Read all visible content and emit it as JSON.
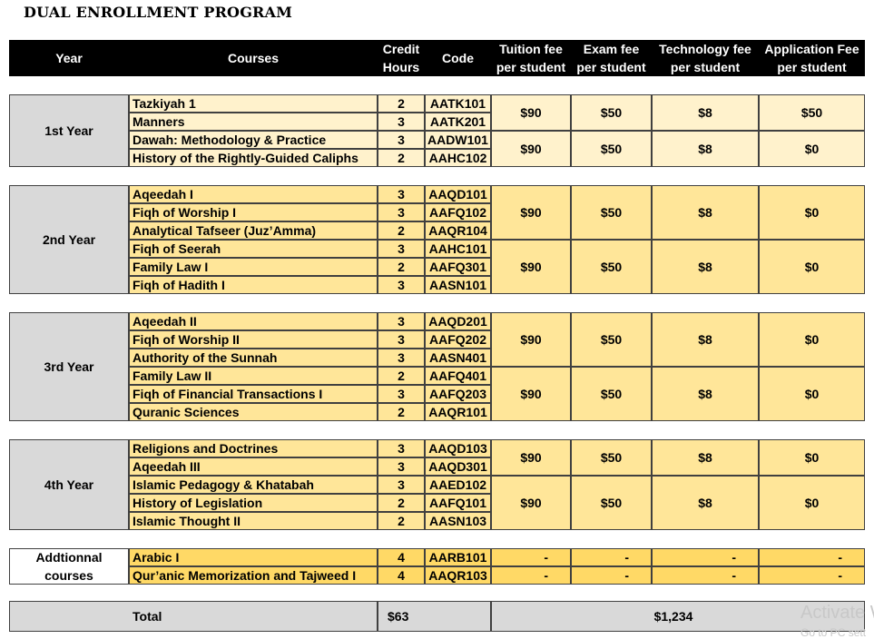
{
  "title": "DUAL ENROLLMENT PROGRAM",
  "colors": {
    "header_bg": "#000000",
    "header_text": "#ffffff",
    "year_bg": "#d9d9d9",
    "year1_row": "#fff2cc",
    "year2_4_row": "#ffe699",
    "additional_row": "#ffd966",
    "border": "#404040"
  },
  "header": {
    "year": "Year",
    "courses": "Courses",
    "credit_line1": "Credit",
    "credit_line2": "Hours",
    "code": "Code",
    "tuition_line1": "Tuition fee",
    "tuition_line2": "per student",
    "exam_line1": "Exam fee",
    "exam_line2": "per student",
    "tech_line1": "Technology fee",
    "tech_line2": "per student",
    "app_line1": "Application Fee",
    "app_line2": "per student"
  },
  "sections": [
    {
      "year": "1st Year",
      "courses": [
        {
          "name": "Tazkiyah 1",
          "credits": "2",
          "code": "AATK101"
        },
        {
          "name": "Manners",
          "credits": "3",
          "code": "AATK201"
        },
        {
          "name": "Dawah: Methodology & Practice",
          "credits": "3",
          "code": "AADW101"
        },
        {
          "name": "History of the Rightly-Guided Caliphs",
          "credits": "2",
          "code": "AAHC102"
        }
      ],
      "fee_groups": [
        {
          "rows": 2,
          "tuition": "$90",
          "exam": "$50",
          "tech": "$8",
          "app": "$50"
        },
        {
          "rows": 2,
          "tuition": "$90",
          "exam": "$50",
          "tech": "$8",
          "app": "$0"
        }
      ]
    },
    {
      "year": "2nd Year",
      "courses": [
        {
          "name": "Aqeedah I",
          "credits": "3",
          "code": "AAQD101"
        },
        {
          "name": "Fiqh of Worship I",
          "credits": "3",
          "code": "AAFQ102"
        },
        {
          "name": "Analytical Tafseer (Juz’Amma)",
          "credits": "2",
          "code": "AAQR104"
        },
        {
          "name": "Fiqh of Seerah",
          "credits": "3",
          "code": "AAHC101"
        },
        {
          "name": "Family Law I",
          "credits": "2",
          "code": "AAFQ301"
        },
        {
          "name": "Fiqh of Hadith I",
          "credits": "3",
          "code": "AASN101"
        }
      ],
      "fee_groups": [
        {
          "rows": 3,
          "tuition": "$90",
          "exam": "$50",
          "tech": "$8",
          "app": "$0"
        },
        {
          "rows": 3,
          "tuition": "$90",
          "exam": "$50",
          "tech": "$8",
          "app": "$0"
        }
      ]
    },
    {
      "year": "3rd Year",
      "courses": [
        {
          "name": "Aqeedah II",
          "credits": "3",
          "code": "AAQD201"
        },
        {
          "name": "Fiqh of Worship II",
          "credits": "3",
          "code": "AAFQ202"
        },
        {
          "name": "Authority of the Sunnah",
          "credits": "3",
          "code": "AASN401"
        },
        {
          "name": "Family Law II",
          "credits": "2",
          "code": "AAFQ401"
        },
        {
          "name": "Fiqh of Financial Transactions I",
          "credits": "3",
          "code": "AAFQ203"
        },
        {
          "name": "Quranic Sciences",
          "credits": "2",
          "code": "AAQR101"
        }
      ],
      "fee_groups": [
        {
          "rows": 3,
          "tuition": "$90",
          "exam": "$50",
          "tech": "$8",
          "app": "$0"
        },
        {
          "rows": 3,
          "tuition": "$90",
          "exam": "$50",
          "tech": "$8",
          "app": "$0"
        }
      ]
    },
    {
      "year": "4th Year",
      "courses": [
        {
          "name": "Religions and Doctrines",
          "credits": "3",
          "code": "AAQD103"
        },
        {
          "name": "Aqeedah III",
          "credits": "3",
          "code": "AAQD301"
        },
        {
          "name": "Islamic Pedagogy & Khatabah",
          "credits": "3",
          "code": "AAED102"
        },
        {
          "name": "History of Legislation",
          "credits": "2",
          "code": "AAFQ101"
        },
        {
          "name": "Islamic Thought II",
          "credits": "2",
          "code": "AASN103"
        }
      ],
      "fee_groups": [
        {
          "rows": 2,
          "tuition": "$90",
          "exam": "$50",
          "tech": "$8",
          "app": "$0"
        },
        {
          "rows": 3,
          "tuition": "$90",
          "exam": "$50",
          "tech": "$8",
          "app": "$0"
        }
      ]
    }
  ],
  "additional": {
    "label_line1": "Addtionnal",
    "label_line2": "courses",
    "courses": [
      {
        "name": "Arabic I",
        "credits": "4",
        "code": "AARB101",
        "tuition": "-",
        "exam": "-",
        "tech": "-",
        "app": "-"
      },
      {
        "name": "Qur’anic Memorization and Tajweed I",
        "credits": "4",
        "code": "AAQR103",
        "tuition": "-",
        "exam": "-",
        "tech": "-",
        "app": "-"
      }
    ]
  },
  "total": {
    "label": "Total",
    "credits_value": "$63",
    "fees_value": "$1,234"
  },
  "watermark": {
    "line1": "Activate W",
    "line2": "Go to PC sett"
  }
}
